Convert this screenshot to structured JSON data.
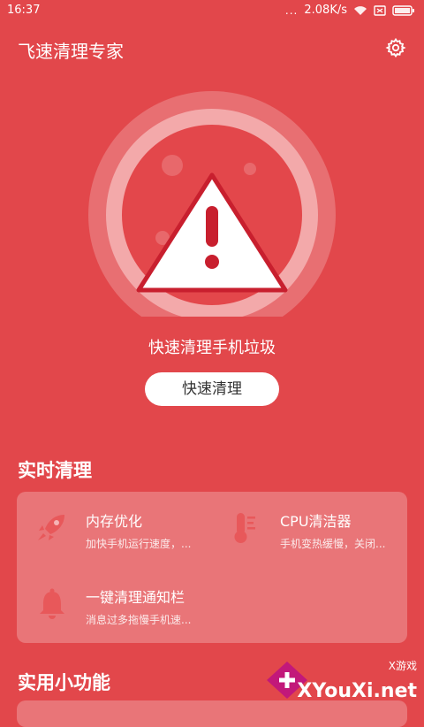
{
  "status": {
    "time": "16:37",
    "signal_dots": "...",
    "speed": "2.08K/s",
    "icons": [
      "wifi-icon",
      "sim-icon",
      "battery-icon"
    ]
  },
  "header": {
    "title": "飞速清理专家",
    "settings_icon": "gear-icon"
  },
  "hero": {
    "icon": "warning-icon",
    "tagline": "快速清理手机垃圾",
    "button_label": "快速清理"
  },
  "realtime": {
    "title": "实时清理",
    "items": [
      {
        "icon": "rocket-icon",
        "title": "内存优化",
        "desc": "加快手机运行速度，..."
      },
      {
        "icon": "thermometer-icon",
        "title": "CPU清洁器",
        "desc": "手机变热缓慢，关闭..."
      },
      {
        "icon": "bell-icon",
        "title": "一键清理通知栏",
        "desc": "消息过多拖慢手机速..."
      }
    ]
  },
  "tools": {
    "title": "实用小功能"
  },
  "watermark": {
    "sub": "X游戏",
    "main": "XYouXi.net"
  },
  "colors": {
    "background": "#e2474b",
    "warning_red": "#c81f2e",
    "icon_red": "#e8585a"
  }
}
